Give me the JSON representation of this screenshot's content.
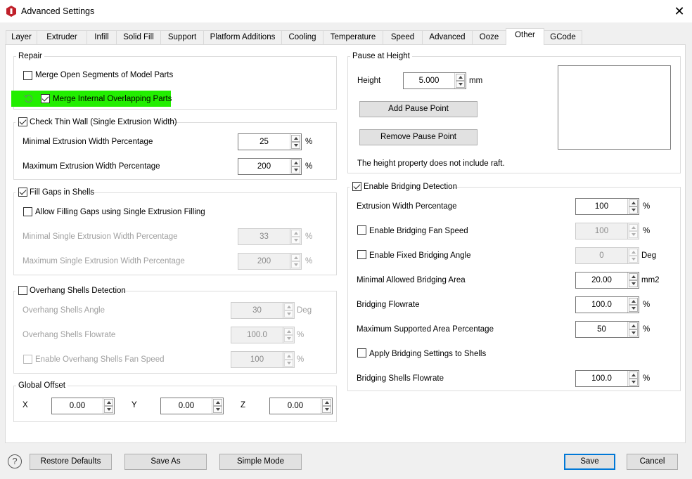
{
  "window": {
    "title": "Advanced Settings",
    "close": "✕"
  },
  "tabs": [
    "Layer",
    "Extruder",
    "Infill",
    "Solid Fill",
    "Support",
    "Platform Additions",
    "Cooling",
    "Temperature",
    "Speed",
    "Advanced",
    "Ooze",
    "Other",
    "GCode"
  ],
  "active_tab": "Other",
  "repair": {
    "title": "Repair",
    "merge_open": {
      "label": "Merge Open Segments of Model Parts",
      "checked": false
    },
    "merge_internal": {
      "label": "Merge Internal Overlapping Parts",
      "checked": true
    }
  },
  "thin_wall": {
    "title": "Check Thin Wall (Single Extrusion Width)",
    "checked": true,
    "min": {
      "label": "Minimal Extrusion Width Percentage",
      "value": "25",
      "unit": "%"
    },
    "max": {
      "label": "Maximum Extrusion Width Percentage",
      "value": "200",
      "unit": "%"
    }
  },
  "fill_gaps": {
    "title": "Fill Gaps in Shells",
    "checked": true,
    "allow": {
      "label": "Allow Filling Gaps using Single Extrusion Filling",
      "checked": false
    },
    "min": {
      "label": "Minimal Single Extrusion Width Percentage",
      "value": "33",
      "unit": "%"
    },
    "max": {
      "label": "Maximum Single Extrusion Width Percentage",
      "value": "200",
      "unit": "%"
    }
  },
  "overhang": {
    "title": "Overhang Shells Detection",
    "checked": false,
    "angle": {
      "label": "Overhang Shells Angle",
      "value": "30",
      "unit": "Deg"
    },
    "flowrate": {
      "label": "Overhang Shells Flowrate",
      "value": "100.0",
      "unit": "%"
    },
    "fan": {
      "label": "Enable Overhang Shells Fan Speed",
      "value": "100",
      "unit": "%",
      "checked": false
    }
  },
  "offset": {
    "title": "Global Offset",
    "x": {
      "label": "X",
      "value": "0.00"
    },
    "y": {
      "label": "Y",
      "value": "0.00"
    },
    "z": {
      "label": "Z",
      "value": "0.00"
    }
  },
  "pause": {
    "title": "Pause at Height",
    "height": {
      "label": "Height",
      "value": "5.000",
      "unit": "mm"
    },
    "add": "Add Pause Point",
    "remove": "Remove Pause Point",
    "note": "The height property does not include raft."
  },
  "bridging": {
    "title": "Enable Bridging Detection",
    "checked": true,
    "width": {
      "label": "Extrusion Width Percentage",
      "value": "100",
      "unit": "%"
    },
    "fan": {
      "label": "Enable Bridging Fan Speed",
      "value": "100",
      "unit": "%",
      "checked": false
    },
    "angle": {
      "label": "Enable Fixed Bridging Angle",
      "value": "0",
      "unit": "Deg",
      "checked": false
    },
    "area": {
      "label": "Minimal Allowed Bridging Area",
      "value": "20.00",
      "unit": "mm2"
    },
    "flowrate": {
      "label": "Bridging Flowrate",
      "value": "100.0",
      "unit": "%"
    },
    "max_area": {
      "label": "Maximum Supported Area Percentage",
      "value": "50",
      "unit": "%"
    },
    "apply": {
      "label": "Apply Bridging Settings to Shells",
      "checked": false
    },
    "shells_flow": {
      "label": "Bridging Shells Flowrate",
      "value": "100.0",
      "unit": "%"
    }
  },
  "footer": {
    "help": "?",
    "restore": "Restore Defaults",
    "save_as": "Save As",
    "simple": "Simple Mode",
    "save": "Save",
    "cancel": "Cancel"
  },
  "colors": {
    "highlight": "#22ee00",
    "accent": "#0078d7",
    "app_icon": "#c0202a"
  }
}
